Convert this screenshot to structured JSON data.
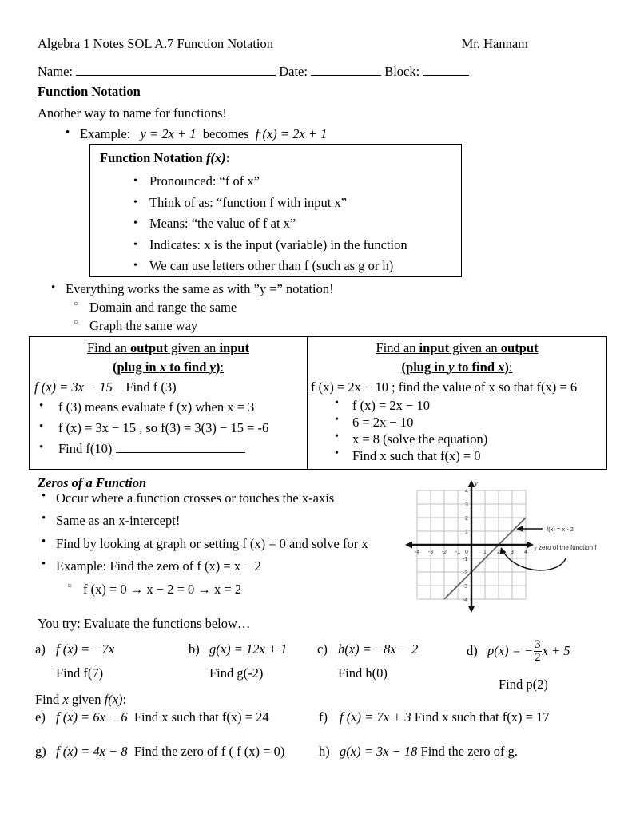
{
  "header": {
    "course_title": "Algebra 1 Notes SOL A.7 Function Notation",
    "teacher": "Mr. Hannam",
    "name_label": "Name:",
    "date_label": "Date:",
    "block_label": "Block:"
  },
  "sections": {
    "function_notation_heading": "Function Notation",
    "intro_line": "Another way to name for functions!",
    "example_prefix": "Example:",
    "example_y": "y = 2x + 1",
    "example_becomes": "becomes",
    "example_fx": "f (x) = 2x + 1"
  },
  "fn_box": {
    "title_prefix": "Function Notation ",
    "title_fx": "f(x)",
    "title_suffix": ":",
    "items": [
      {
        "label": "Pronounced:  “f of x”"
      },
      {
        "label": "Think of as:  “function f with input x”"
      },
      {
        "label": "Means:  “the value of f at x”"
      },
      {
        "label": "Indicates:  x is the input (variable) in the function"
      },
      {
        "label": "We can use letters other than f (such as g or h)"
      }
    ]
  },
  "after_box": {
    "bullet_main": "Everything works the same as with ”y =” notation!",
    "sub_items": [
      "Domain and range the same",
      "Graph the same way"
    ]
  },
  "table": {
    "left": {
      "head_line1_a": "Find an ",
      "head_line1_b": "output",
      "head_line1_c": " given an ",
      "head_line1_d": "input",
      "head_line2_a": "(plug in ",
      "head_line2_b": "x",
      "head_line2_c": " to find ",
      "head_line2_d": "y",
      "head_line2_e": ")",
      "head_line2_f": ":",
      "given_eq": "f (x) = 3x − 15",
      "given_task": "Find f (3)",
      "bullets": [
        "f (3) means evaluate f (x) when x = 3",
        "f (x) = 3x − 15 , so f(3) = 3(3) − 15 = -6",
        "Find f(10)"
      ]
    },
    "right": {
      "head_line1_a": "Find an ",
      "head_line1_b": "input",
      "head_line1_c": " given an ",
      "head_line1_d": "output",
      "head_line2_a": "(plug in ",
      "head_line2_b": "y",
      "head_line2_c": " to find ",
      "head_line2_d": "x",
      "head_line2_e": ")",
      "head_line2_f": ":",
      "given_line": "f (x) = 2x − 10 ;  find the value of x so that f(x) = 6",
      "bullets": [
        "f (x) = 2x − 10",
        "6 = 2x − 10",
        "x = 8 (solve the equation)",
        "Find x such that f(x) = 0"
      ]
    }
  },
  "zeros": {
    "title": "Zeros of a Function",
    "bullets": [
      "Occur where a function crosses or touches the x-axis",
      "Same as an x-intercept!",
      "Find by looking at graph or setting f (x) = 0 and solve for x",
      "Example:  Find the zero of f (x) = x − 2"
    ],
    "sub_bullet": "f (x) = 0 →  x − 2 = 0 → x = 2",
    "you_try": "You try:  Evaluate the functions below…"
  },
  "chart_data": {
    "type": "line",
    "title": "",
    "xlabel": "x",
    "ylabel": "y",
    "xlim": [
      -4,
      4
    ],
    "ylim": [
      -4,
      4
    ],
    "xticks": [
      -4,
      -3,
      -2,
      -1,
      0,
      1,
      2,
      3,
      4
    ],
    "yticks": [
      -4,
      -3,
      -2,
      -1,
      1,
      2,
      3,
      4
    ],
    "grid": true,
    "series": [
      {
        "name": "f(x) = x - 2",
        "slope": 1,
        "intercept": -2,
        "points": [
          [
            -2,
            -4
          ],
          [
            0,
            -2
          ],
          [
            2,
            0
          ],
          [
            4,
            2
          ]
        ]
      }
    ],
    "annotations": [
      {
        "text": "f(x) = x - 2",
        "kind": "callout-arrow",
        "target": [
          3.3,
          1.3
        ]
      },
      {
        "text": "zero of the function f",
        "kind": "curved-arrow",
        "target": [
          2,
          0
        ]
      }
    ],
    "origin_label": "0"
  },
  "exercises_evaluate": [
    {
      "letter": "a)",
      "equation": "f (x) = −7x",
      "find": "Find f(7)"
    },
    {
      "letter": "b)",
      "equation": "g(x) = 12x + 1",
      "find": "Find g(-2)"
    },
    {
      "letter": "c)",
      "equation": "h(x) = −8x − 2",
      "find": "Find h(0)"
    },
    {
      "letter": "d)",
      "equation_prefix": "p(x) = −",
      "frac_num": "3",
      "frac_den": "2",
      "equation_suffix": "x + 5",
      "find": "Find p(2)"
    }
  ],
  "exercises_findx": {
    "heading_a": "Find ",
    "heading_b": "x",
    "heading_c": " given ",
    "heading_d": "f(x)",
    "heading_e": ":",
    "items": [
      {
        "letter": "e)",
        "equation": "f (x) = 6x − 6",
        "task": "Find x such that f(x) = 24"
      },
      {
        "letter": "f)",
        "equation": "f (x) = 7x + 3",
        "task": "Find x such that f(x) = 17"
      },
      {
        "letter": "g)",
        "equation": "f (x) = 4x − 8",
        "task": "Find the zero of f  ( f (x) = 0)"
      },
      {
        "letter": "h)",
        "equation": "g(x) = 3x − 18",
        "task": "Find the zero of g."
      }
    ]
  },
  "colors": {
    "text": "#000000",
    "page_bg": "#ffffff",
    "grid": "#b8b8b8",
    "axis": "#1a1a1a",
    "plot_line": "#5a5a5a"
  }
}
